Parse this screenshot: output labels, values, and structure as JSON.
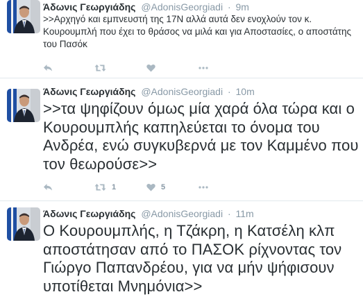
{
  "tweets": [
    {
      "fullname": "Άδωνις Γεωργιάδης",
      "screenname": "@AdonisGeorgiadi",
      "dot": "·",
      "time": "9m",
      "text": ">>Αρχηγό και εμπνευστή της 17Ν αλλά αυτά δεν ενοχλούν τον κ. Κουρουμπλή που έχει το θράσος να μιλά και για Αποστασίες, ο αποστάτης του Πασόκ",
      "retweets": "",
      "likes": ""
    },
    {
      "fullname": "Άδωνις Γεωργιάδης",
      "screenname": "@AdonisGeorgiadi",
      "dot": "·",
      "time": "10m",
      "text": ">>τα ψηφίζουν όμως μία χαρά όλα τώρα και ο Κουρουμπλής καπηλεύεται το όνομα του Ανδρέα, ενώ συγκυβερνά με τον Καμμένο που τον θεωρούσε>>",
      "retweets": "1",
      "likes": "5"
    },
    {
      "fullname": "Άδωνις Γεωργιάδης",
      "screenname": "@AdonisGeorgiadi",
      "dot": "·",
      "time": "11m",
      "text": "Ο Κουρουμπλής, η Τζάκρη, η Κατσέλη κλπ αποστάτησαν από το ΠΑΣΟΚ ρίχνοντας τον Γιώργο Παπανδρέου, για να μήν ψήφισουν υποτίθεται Μνημόνια>>",
      "retweets": "",
      "likes": ""
    }
  ],
  "icons": {
    "reply": "reply-icon",
    "retweet": "retweet-icon",
    "like": "heart-icon",
    "more": "more-dots-icon"
  },
  "colors": {
    "text": "#292f33",
    "muted": "#8899a6",
    "icon": "#aab8c2",
    "divider": "#e1e8ed"
  }
}
